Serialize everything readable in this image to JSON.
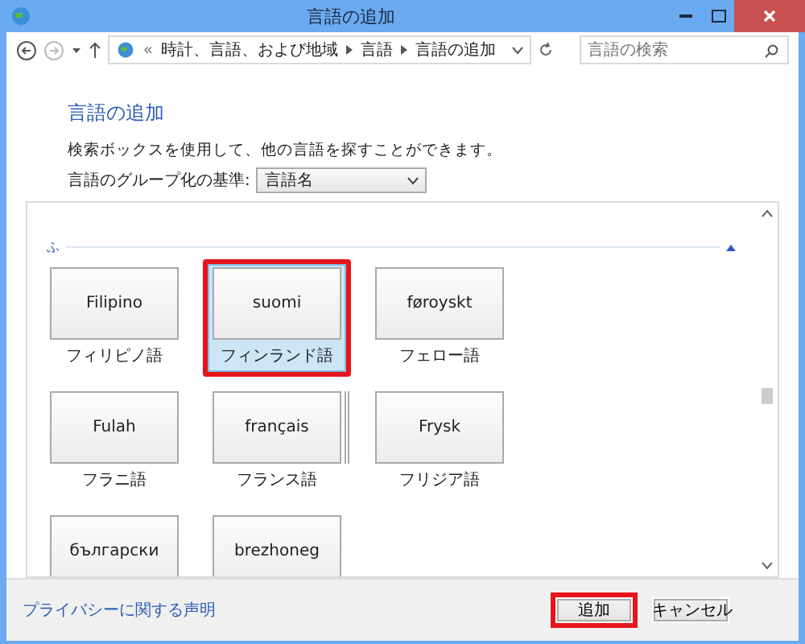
{
  "window": {
    "title": "言語の追加"
  },
  "nav": {
    "breadcrumb_prefix": "«",
    "breadcrumbs": [
      "時計、言語、および地域",
      "言語",
      "言語の追加"
    ],
    "search": {
      "placeholder": "言語の検索"
    }
  },
  "heading": "言語の追加",
  "description": "検索ボックスを使用して、他の言語を探すことができます。",
  "grouping": {
    "label": "言語のグループ化の基準:",
    "value": "言語名"
  },
  "section": {
    "letter": "ふ",
    "expanded": true
  },
  "tiles": [
    {
      "name": "Filipino",
      "label": "フィリピノ語",
      "selected": false,
      "highlighted": false,
      "stacked": false
    },
    {
      "name": "suomi",
      "label": "フィンランド語",
      "selected": true,
      "highlighted": true,
      "stacked": false
    },
    {
      "name": "føroyskt",
      "label": "フェロー語",
      "selected": false,
      "highlighted": false,
      "stacked": false
    },
    {
      "name": "Fulah",
      "label": "フラニ語",
      "selected": false,
      "highlighted": false,
      "stacked": false
    },
    {
      "name": "français",
      "label": "フランス語",
      "selected": false,
      "highlighted": false,
      "stacked": true
    },
    {
      "name": "Frysk",
      "label": "フリジア語",
      "selected": false,
      "highlighted": false,
      "stacked": false
    },
    {
      "name": "български",
      "selected": false,
      "highlighted": false,
      "stacked": false
    },
    {
      "name": "brezhoneg",
      "selected": false,
      "highlighted": false,
      "stacked": false
    }
  ],
  "footer": {
    "privacy_link": "プライバシーに関する声明",
    "buttons": [
      {
        "label": "追加",
        "highlighted": true
      },
      {
        "label": "キャンセル",
        "highlighted": false
      }
    ]
  }
}
